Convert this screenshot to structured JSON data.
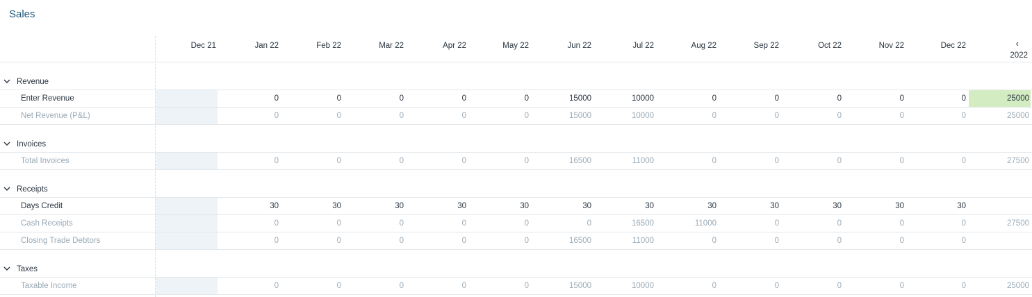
{
  "title": "Sales",
  "columns": [
    "Dec 21",
    "Jan 22",
    "Feb 22",
    "Mar 22",
    "Apr 22",
    "May 22",
    "Jun 22",
    "Jul 22",
    "Aug 22",
    "Sep 22",
    "Oct 22",
    "Nov 22",
    "Dec 22"
  ],
  "total_header": {
    "arrow": "‹",
    "year": "2022"
  },
  "sections": [
    {
      "name": "Revenue",
      "rows": [
        {
          "label": "Enter Revenue",
          "muted": false,
          "values": [
            "",
            "0",
            "0",
            "0",
            "0",
            "0",
            "15000",
            "10000",
            "0",
            "0",
            "0",
            "0",
            "0"
          ],
          "total": "25000",
          "highlight_total": true
        },
        {
          "label": "Net Revenue (P&L)",
          "muted": true,
          "values": [
            "",
            "0",
            "0",
            "0",
            "0",
            "0",
            "15000",
            "10000",
            "0",
            "0",
            "0",
            "0",
            "0"
          ],
          "total": "25000",
          "highlight_total": false
        }
      ]
    },
    {
      "name": "Invoices",
      "rows": [
        {
          "label": "Total Invoices",
          "muted": true,
          "values": [
            "",
            "0",
            "0",
            "0",
            "0",
            "0",
            "16500",
            "11000",
            "0",
            "0",
            "0",
            "0",
            "0"
          ],
          "total": "27500",
          "highlight_total": false
        }
      ]
    },
    {
      "name": "Receipts",
      "rows": [
        {
          "label": "Days Credit",
          "muted": false,
          "values": [
            "",
            "30",
            "30",
            "30",
            "30",
            "30",
            "30",
            "30",
            "30",
            "30",
            "30",
            "30",
            "30"
          ],
          "total": "",
          "highlight_total": false
        },
        {
          "label": "Cash Receipts",
          "muted": true,
          "values": [
            "",
            "0",
            "0",
            "0",
            "0",
            "0",
            "0",
            "16500",
            "11000",
            "0",
            "0",
            "0",
            "0"
          ],
          "total": "27500",
          "highlight_total": false
        },
        {
          "label": "Closing Trade Debtors",
          "muted": true,
          "values": [
            "",
            "0",
            "0",
            "0",
            "0",
            "0",
            "16500",
            "11000",
            "0",
            "0",
            "0",
            "0",
            "0"
          ],
          "total": "",
          "highlight_total": false
        }
      ]
    },
    {
      "name": "Taxes",
      "rows": [
        {
          "label": "Taxable Income",
          "muted": true,
          "values": [
            "",
            "0",
            "0",
            "0",
            "0",
            "0",
            "15000",
            "10000",
            "0",
            "0",
            "0",
            "0",
            "0"
          ],
          "total": "25000",
          "highlight_total": false
        }
      ]
    }
  ],
  "colors": {
    "title": "#1f5a7a",
    "highlight": "#d4ecc1",
    "shade": "#eef3f7",
    "muted_text": "#9aaab6"
  },
  "icons": {
    "section_toggle": "chevron-down-icon",
    "collapse": "chevron-left-icon"
  }
}
